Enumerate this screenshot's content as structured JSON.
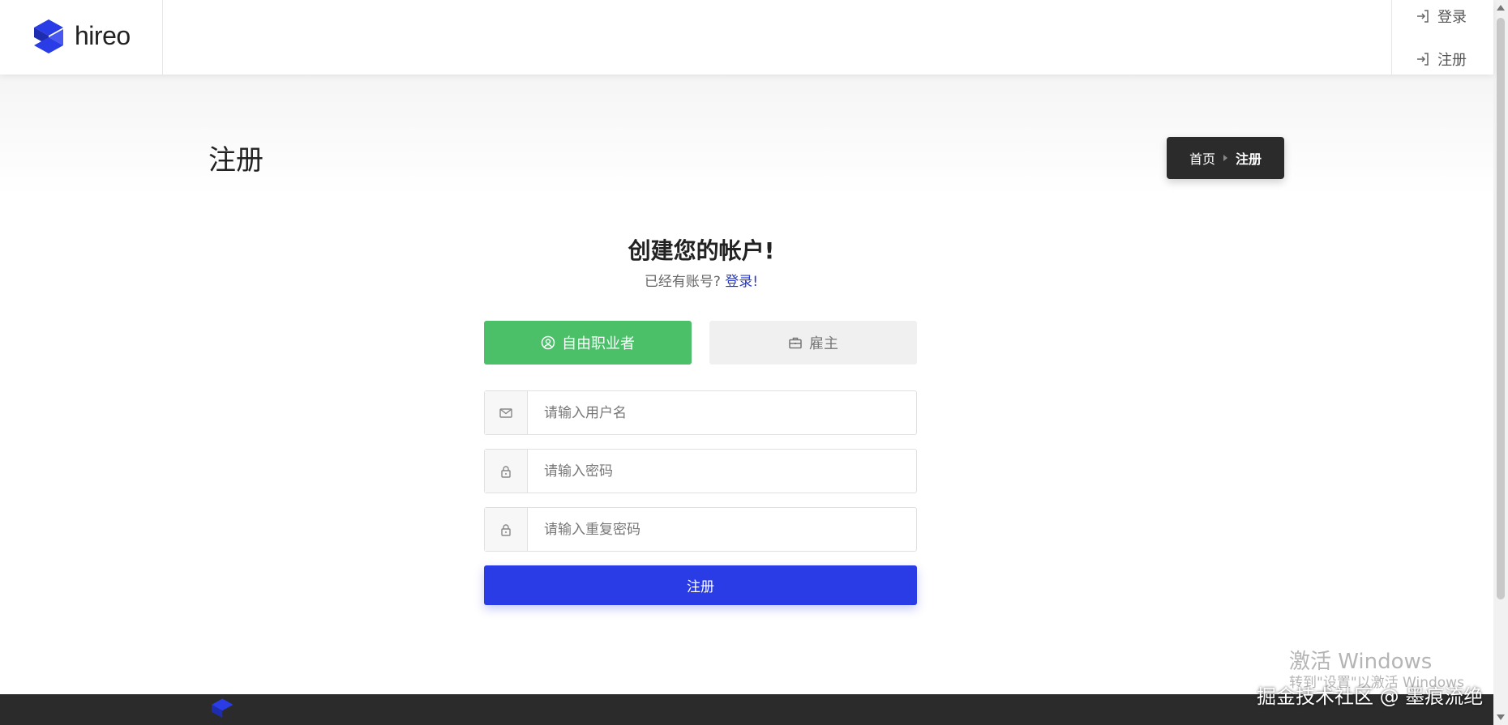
{
  "header": {
    "logo_text": "hireo",
    "login_label": "登录",
    "register_label": "注册"
  },
  "page": {
    "title": "注册",
    "breadcrumb": [
      "首页",
      "注册"
    ]
  },
  "form": {
    "heading": "创建您的帐户!",
    "sub_prefix": "已经有账号?",
    "sub_link": "登录!",
    "roles": {
      "freelancer": "自由职业者",
      "employer": "雇主"
    },
    "username_placeholder": "请输入用户名",
    "password_placeholder": "请输入密码",
    "repeat_password_placeholder": "请输入重复密码",
    "submit_label": "注册"
  },
  "icons": {
    "login": "login-icon",
    "register": "login-icon",
    "freelancer": "user-circle-icon",
    "employer": "briefcase-icon",
    "username": "envelope-icon",
    "password": "lock-icon",
    "repeat_password": "lock-icon"
  },
  "colors": {
    "primary": "#2a3ce6",
    "freelancer_active": "#4cbf69",
    "breadcrumb_bg": "#2b2b2b",
    "footer_bg": "#2b2b2b"
  },
  "watermark": {
    "activate_title": "激活 Windows",
    "activate_sub": "转到\"设置\"以激活 Windows",
    "credit": "掘金技术社区 @ 墨痕流绝"
  }
}
